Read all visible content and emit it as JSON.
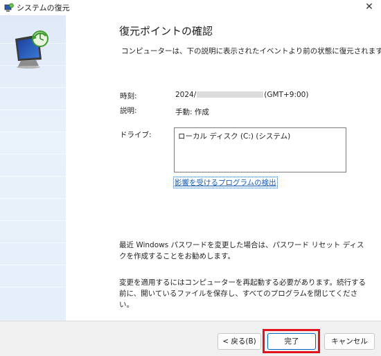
{
  "window": {
    "title": "システムの復元"
  },
  "page": {
    "heading": "復元ポイントの確認",
    "intro": "コンピューターは、下の説明に表示されたイベントより前の状態に復元されます。",
    "time_label": "時刻:",
    "time_prefix": "2024/",
    "time_suffix": "(GMT+9:00)",
    "desc_label": "説明:",
    "desc_value": "手動: 作成",
    "drive_label": "ドライブ:",
    "drives": [
      "ローカル ディスク (C:) (システム)"
    ],
    "link": "影響を受けるプログラムの検出",
    "note_password": "最近 Windows パスワードを変更した場合は、パスワード リセット ディスクを作成することをお勧めします。",
    "note_restart": "変更を適用するにはコンピューターを再起動する必要があります。続行する前に、開いているファイルを保存し、すべてのプログラムを閉じてください。"
  },
  "buttons": {
    "back": "< 戻る(B)",
    "finish": "完了",
    "cancel": "キャンセル"
  },
  "colors": {
    "accent": "#0067c0",
    "highlight": "#e0131f",
    "link": "#1a5fb4",
    "sidebar": "#e3ecf8"
  }
}
